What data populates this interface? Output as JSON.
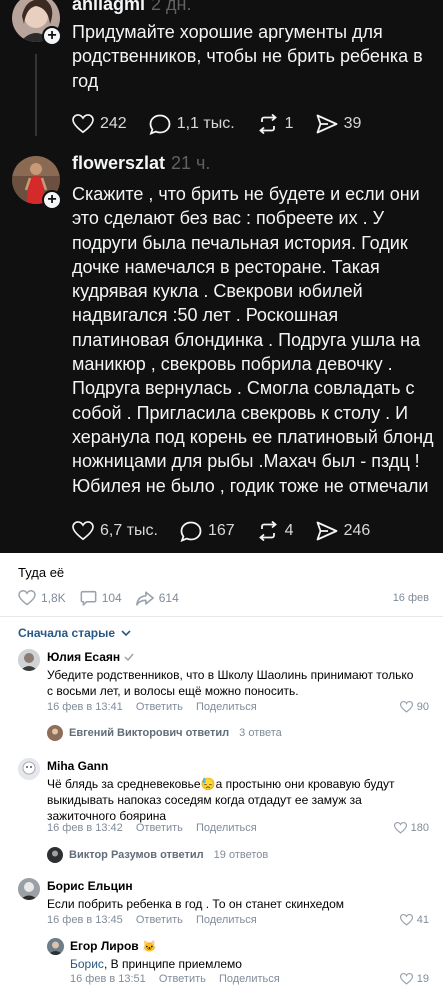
{
  "threads": {
    "post1": {
      "username": "anilagmi",
      "time": "2 дн.",
      "text": "Придумайте хорошие аргументы для родственников, чтобы не брить ребенка в год",
      "likes": "242",
      "comments": "1,1 тыс.",
      "reposts": "1",
      "shares": "39"
    },
    "post2": {
      "username": "flowerszlat",
      "time": "21 ч.",
      "text": "Скажите , что брить не будете и если они это сделают без вас : побреете их . У подруги была печальная история. Годик дочке намечался в ресторане. Такая кудрявая кукла . Свекрови юбилей надвигался :50 лет . Роскошная платиновая блондинка . Подруга ушла на маникюр , свекровь побрила девочку . Подруга вернулась . Смогла совладать с собой . Пригласила свекровь к столу . И херанула под корень ее платиновый блонд ножницами для рыбы .Махач был - пздц ! Юбилея не было , годик тоже не отмечали",
      "likes": "6,7 тыс.",
      "comments": "167",
      "reposts": "4",
      "shares": "246"
    }
  },
  "vk": {
    "post_text": "Туда её",
    "likes": "1,8K",
    "comments": "104",
    "shares": "614",
    "date": "16 фев",
    "sort_label": "Сначала старые",
    "reply_action": "Ответить",
    "share_action": "Поделиться",
    "comments_list": [
      {
        "name": "Юлия Есаян",
        "text": "Убедите родственников, что в Школу Шаолинь принимают только с восьми лет, и волосы ещё можно поносить.",
        "time": "16 фев в 13:41",
        "likes": "90",
        "replied_by": "Евгений Викторович ответил",
        "reply_count": "3 ответа"
      },
      {
        "name": "Miha Gann",
        "text_before_emoji": "Чё блядь за средневековье",
        "emoji": "😓",
        "text_after_emoji": "а простыню они кровавую будут выкидывать напоказ соседям когда отдадут ее замуж за зажиточного боярина",
        "time": "16 фев в 13:42",
        "likes": "180",
        "replied_by": "Виктор Разумов ответил",
        "reply_count": "19 ответов"
      },
      {
        "name": "Борис Ельцин",
        "text": "Если побрить ребенка в год . То он станет скинхедом",
        "time": "16 фев в 13:45",
        "likes": "41"
      }
    ],
    "reply": {
      "name": "Егор Лиров",
      "name_emoji": "🐱",
      "ref_name": "Борис",
      "text": ", В принципе приемлемо",
      "time": "16 фев в 13:51",
      "likes": "19"
    }
  },
  "colors": {
    "dark_bg": "#101010",
    "vk_link": "#2a5885",
    "vk_meta": "#818c99"
  }
}
